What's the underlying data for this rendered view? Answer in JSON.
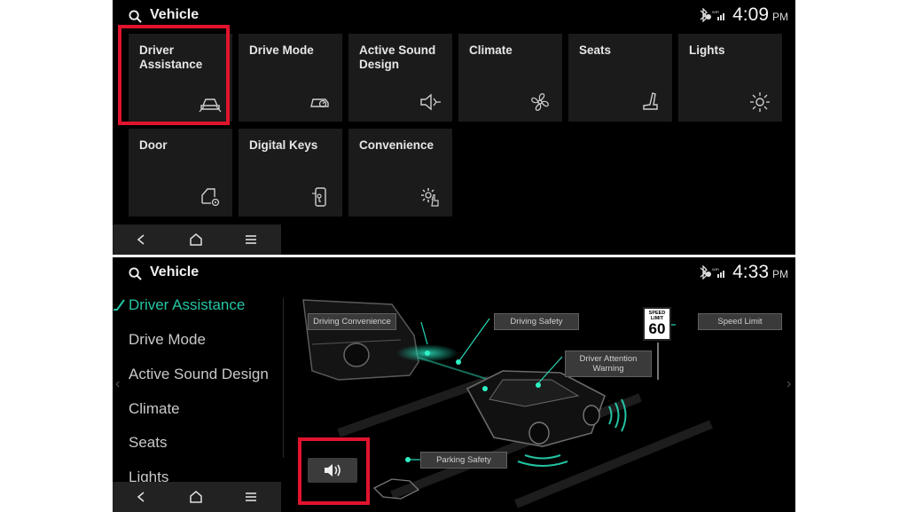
{
  "screen1": {
    "title": "Vehicle",
    "time": "4:09",
    "ampm": "PM",
    "tiles": [
      {
        "label": "Driver Assistance",
        "icon": "driver-assistance-icon"
      },
      {
        "label": "Drive Mode",
        "icon": "drive-mode-icon"
      },
      {
        "label": "Active Sound Design",
        "icon": "speaker-icon"
      },
      {
        "label": "Climate",
        "icon": "fan-icon"
      },
      {
        "label": "Seats",
        "icon": "seat-icon"
      },
      {
        "label": "Lights",
        "icon": "light-icon"
      },
      {
        "label": "Door",
        "icon": "door-settings-icon"
      },
      {
        "label": "Digital Keys",
        "icon": "digital-key-icon"
      },
      {
        "label": "Convenience",
        "icon": "convenience-gear-icon"
      }
    ]
  },
  "screen2": {
    "title": "Vehicle",
    "time": "4:33",
    "ampm": "PM",
    "menu": [
      {
        "label": "Driver Assistance",
        "active": true
      },
      {
        "label": "Drive Mode"
      },
      {
        "label": "Active Sound Design"
      },
      {
        "label": "Climate"
      },
      {
        "label": "Seats"
      },
      {
        "label": "Lights"
      }
    ],
    "callouts": {
      "driving_convenience": "Driving Convenience",
      "driving_safety": "Driving Safety",
      "driver_attention": "Driver Attention Warning",
      "speed_limit": "Speed Limit",
      "parking_safety": "Parking Safety"
    },
    "speed_sign": {
      "top": "SPEED LIMIT",
      "value": "60"
    }
  },
  "colors": {
    "accent": "#24c6a4",
    "highlight": "#e2132d",
    "tile": "#1b1b1b"
  }
}
